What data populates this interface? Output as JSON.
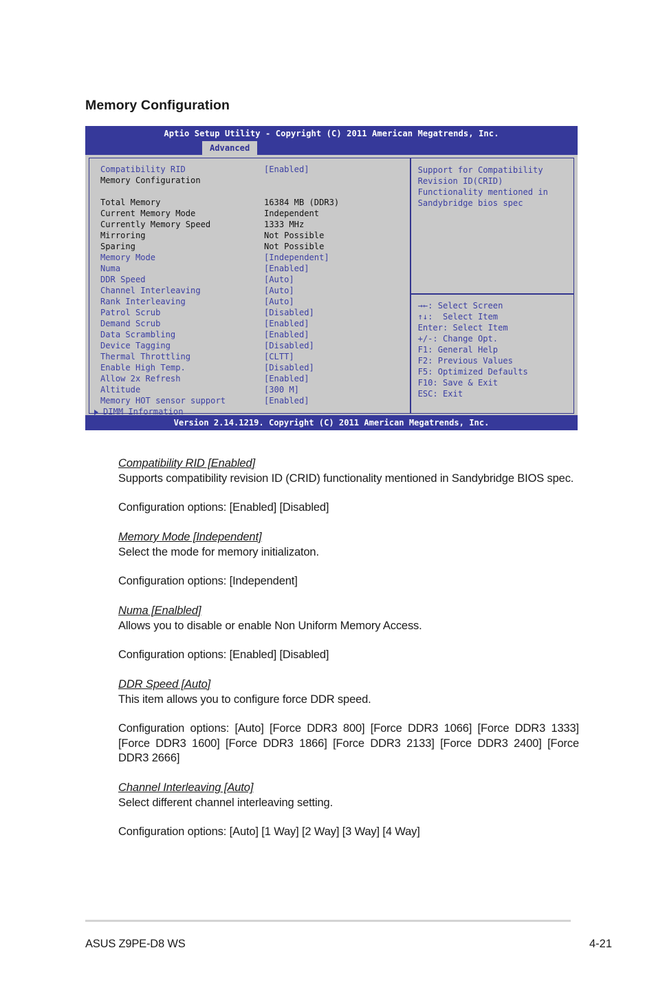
{
  "page": {
    "section_title": "Memory Configuration",
    "footer_left": "ASUS Z9PE-D8 WS",
    "footer_page": "4-21"
  },
  "bios": {
    "titlebar": "Aptio Setup Utility - Copyright (C) 2011 American Megatrends, Inc.",
    "active_tab": "Advanced",
    "footer": "Version 2.14.1219. Copyright (C) 2011 American Megatrends, Inc.",
    "items": [
      {
        "label": "Compatibility RID",
        "value": "[Enabled]",
        "label_color": "blue",
        "value_color": "blue"
      },
      {
        "label": "Memory Configuration",
        "value": "",
        "label_color": "black",
        "value_color": "black"
      },
      {
        "label": "",
        "value": "",
        "label_color": "black",
        "value_color": "black"
      },
      {
        "label": "Total Memory",
        "value": "16384 MB (DDR3)",
        "label_color": "black",
        "value_color": "black"
      },
      {
        "label": "Current Memory Mode",
        "value": "Independent",
        "label_color": "black",
        "value_color": "black"
      },
      {
        "label": "Currently Memory Speed",
        "value": "1333 MHz",
        "label_color": "black",
        "value_color": "black"
      },
      {
        "label": "Mirroring",
        "value": "Not Possible",
        "label_color": "black",
        "value_color": "black"
      },
      {
        "label": "Sparing",
        "value": "Not Possible",
        "label_color": "black",
        "value_color": "black"
      },
      {
        "label": "Memory Mode",
        "value": "[Independent]",
        "label_color": "blue",
        "value_color": "blue"
      },
      {
        "label": "Numa",
        "value": "[Enabled]",
        "label_color": "blue",
        "value_color": "blue"
      },
      {
        "label": "DDR Speed",
        "value": "[Auto]",
        "label_color": "blue",
        "value_color": "blue"
      },
      {
        "label": "Channel Interleaving",
        "value": "[Auto]",
        "label_color": "blue",
        "value_color": "blue"
      },
      {
        "label": "Rank Interleaving",
        "value": "[Auto]",
        "label_color": "blue",
        "value_color": "blue"
      },
      {
        "label": "Patrol Scrub",
        "value": "[Disabled]",
        "label_color": "blue",
        "value_color": "blue"
      },
      {
        "label": "Demand Scrub",
        "value": "[Enabled]",
        "label_color": "blue",
        "value_color": "blue"
      },
      {
        "label": "Data Scrambling",
        "value": "[Enabled]",
        "label_color": "blue",
        "value_color": "blue"
      },
      {
        "label": "Device Tagging",
        "value": "[Disabled]",
        "label_color": "blue",
        "value_color": "blue"
      },
      {
        "label": "Thermal Throttling",
        "value": "[CLTT]",
        "label_color": "blue",
        "value_color": "blue"
      },
      {
        "label": "Enable High Temp.",
        "value": "[Disabled]",
        "label_color": "blue",
        "value_color": "blue"
      },
      {
        "label": "Allow 2x Refresh",
        "value": "[Enabled]",
        "label_color": "blue",
        "value_color": "blue"
      },
      {
        "label": "Altitude",
        "value": "[300 M]",
        "label_color": "blue",
        "value_color": "blue"
      },
      {
        "label": "Memory HOT sensor support",
        "value": "[Enabled]",
        "label_color": "blue",
        "value_color": "blue"
      }
    ],
    "submenu": "DIMM Information",
    "help_description": "Support for Compatibility\nRevision ID(CRID)\nFunctionality mentioned in\nSandybridge bios spec",
    "help_keys": [
      "→←: Select Screen",
      "↑↓:  Select Item",
      "Enter: Select Item",
      "+/-: Change Opt.",
      "F1: General Help",
      "F2: Previous Values",
      "F5: Optimized Defaults",
      "F10: Save & Exit",
      "ESC: Exit"
    ]
  },
  "prose": {
    "b1_head": "Compatibility RID [Enabled]",
    "b1_desc": "Supports compatibility revision ID (CRID) functionality mentioned in Sandybridge BIOS spec.",
    "b1_opts": "Configuration options: [Enabled] [Disabled]",
    "b2_head": "Memory Mode [Independent]",
    "b2_desc": "Select the mode for memory initializaton.",
    "b2_opts": "Configuration options: [Independent]",
    "b3_head": "Numa [Enalbled]",
    "b3_desc": "Allows you to disable or enable Non Uniform Memory Access.",
    "b3_opts": "Configuration options: [Enabled] [Disabled]",
    "b4_head": "DDR Speed [Auto]",
    "b4_desc": "This item allows you to configure force DDR speed.",
    "b4_opts": "Configuration options: [Auto] [Force DDR3 800] [Force DDR3 1066] [Force DDR3 1333] [Force DDR3 1600] [Force DDR3 1866] [Force DDR3 2133] [Force DDR3 2400] [Force DDR3 2666]",
    "b5_head": "Channel Interleaving [Auto]",
    "b5_desc": "Select different channel interleaving setting.",
    "b5_opts": "Configuration options: [Auto] [1 Way] [2 Way] [3 Way] [4 Way]"
  }
}
